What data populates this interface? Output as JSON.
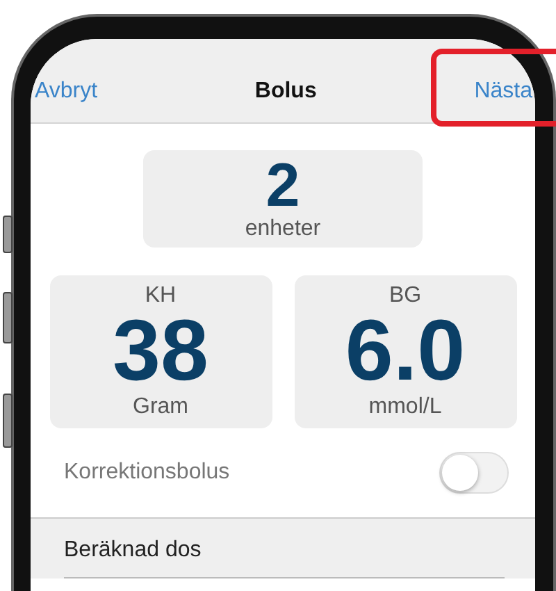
{
  "nav_bar": {
    "cancel": "Avbryt",
    "title": "Bolus",
    "next": "Nästa",
    "next_highlighted": true
  },
  "dose": {
    "value": "2",
    "unit": "enheter"
  },
  "inputs": [
    {
      "label": "KH",
      "value": "38",
      "unit": "Gram"
    },
    {
      "label": "BG",
      "value": "6.0",
      "unit": "mmol/L"
    }
  ],
  "correction": {
    "label": "Korrektionsbolus",
    "on": false
  },
  "section": {
    "title": "Beräknad dos"
  }
}
